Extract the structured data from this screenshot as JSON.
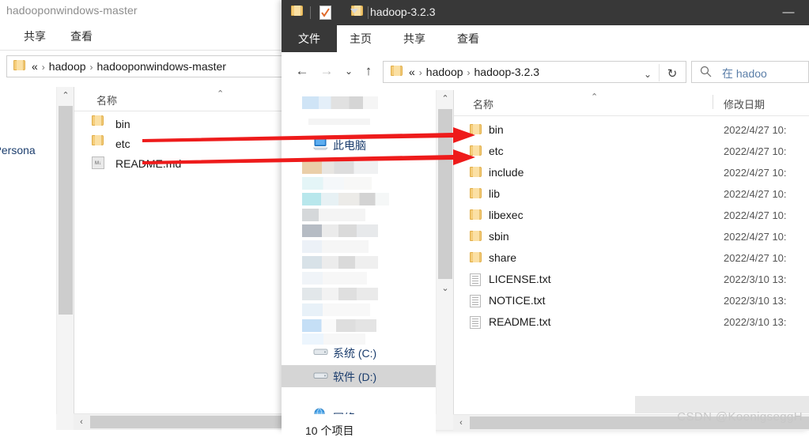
{
  "left_window": {
    "title": "hadooponwindows-master",
    "ribbon_tabs": [
      "共享",
      "查看"
    ],
    "address": {
      "folder_icon": "folder-icon",
      "crumbs": [
        "«",
        "hadoop",
        "hadooponwindows-master"
      ],
      "separator": "›"
    },
    "nav_pane": {
      "item": "- Persona"
    },
    "columns": {
      "name": "名称"
    },
    "files": [
      {
        "icon": "folder-icon",
        "name": "bin"
      },
      {
        "icon": "folder-icon",
        "name": "etc"
      },
      {
        "icon": "markdown-file-icon",
        "name": "README.md",
        "icon_text": "M↓"
      }
    ]
  },
  "right_window": {
    "title": "hadoop-3.2.3",
    "quick_access": [
      "folder-icon",
      "properties-icon",
      "new-folder-icon",
      "chevron-down-icon"
    ],
    "minimize_glyph": "—",
    "ribbon_tabs": [
      "文件",
      "主页",
      "共享",
      "查看"
    ],
    "toolbar": {
      "back": "←",
      "forward": "→",
      "recent": "⌄",
      "up": "↑",
      "refresh": "↻",
      "dropdown": "⌄"
    },
    "address": {
      "folder_icon": "folder-icon",
      "crumbs": [
        "«",
        "hadoop",
        "hadoop-3.2.3"
      ],
      "separator": "›"
    },
    "search": {
      "icon": "search-icon",
      "placeholder": "在 hadoo"
    },
    "nav_pane": {
      "this_pc": "此电脑",
      "drives": [
        {
          "icon": "drive-icon",
          "label": "系统 (C:)",
          "selected": false
        },
        {
          "icon": "drive-icon",
          "label": "软件 (D:)",
          "selected": true
        }
      ],
      "network": {
        "icon": "network-icon",
        "label": "网络"
      }
    },
    "columns": {
      "name": "名称",
      "modified": "修改日期"
    },
    "files": [
      {
        "icon": "folder-icon",
        "name": "bin",
        "modified": "2022/4/27 10:"
      },
      {
        "icon": "folder-icon",
        "name": "etc",
        "modified": "2022/4/27 10:"
      },
      {
        "icon": "folder-icon",
        "name": "include",
        "modified": "2022/4/27 10:"
      },
      {
        "icon": "folder-icon",
        "name": "lib",
        "modified": "2022/4/27 10:"
      },
      {
        "icon": "folder-icon",
        "name": "libexec",
        "modified": "2022/4/27 10:"
      },
      {
        "icon": "folder-icon",
        "name": "sbin",
        "modified": "2022/4/27 10:"
      },
      {
        "icon": "folder-icon",
        "name": "share",
        "modified": "2022/4/27 10:"
      },
      {
        "icon": "text-file-icon",
        "name": "LICENSE.txt",
        "modified": "2022/3/10 13:"
      },
      {
        "icon": "text-file-icon",
        "name": "NOTICE.txt",
        "modified": "2022/3/10 13:"
      },
      {
        "icon": "text-file-icon",
        "name": "README.txt",
        "modified": "2022/3/10 13:"
      }
    ],
    "status": "10 个项目"
  },
  "annotations": {
    "arrow_color": "#ee1b1b",
    "arrows": [
      {
        "name": "arrow-to-bin"
      },
      {
        "name": "arrow-to-etc"
      }
    ]
  },
  "watermark": "CSDN @KoenigseggH"
}
